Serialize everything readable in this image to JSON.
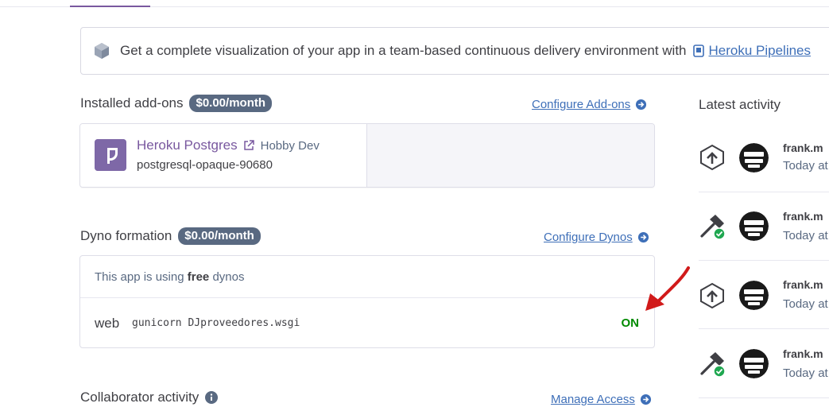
{
  "banner": {
    "text": "Get a complete visualization of your app in a team-based continuous delivery environment with",
    "link": "Heroku Pipelines"
  },
  "addons": {
    "title": "Installed add-ons",
    "price": "$0.00/month",
    "configure_link": "Configure Add-ons",
    "items": [
      {
        "name": "Heroku Postgres",
        "plan": "Hobby Dev",
        "id": "postgresql-opaque-90680"
      }
    ]
  },
  "dynos": {
    "title": "Dyno formation",
    "price": "$0.00/month",
    "configure_link": "Configure Dynos",
    "info_prefix": "This app is using",
    "info_bold": "free",
    "info_suffix": "dynos",
    "processes": [
      {
        "type": "web",
        "command": "gunicorn DJproveedores.wsgi",
        "state": "ON"
      }
    ]
  },
  "collaborators": {
    "title": "Collaborator activity",
    "manage_link": "Manage Access"
  },
  "activity": {
    "title": "Latest activity",
    "items": [
      {
        "kind": "deploy-icon",
        "user": "frank.m",
        "time": "Today at"
      },
      {
        "kind": "build-succeeded-icon",
        "user": "frank.m",
        "time": "Today at"
      },
      {
        "kind": "deploy-icon",
        "user": "frank.m",
        "time": "Today at"
      },
      {
        "kind": "build-succeeded-icon",
        "user": "frank.m",
        "time": "Today at"
      }
    ]
  },
  "colors": {
    "accent": "#79589f",
    "link": "#3e6fb8",
    "badge": "#596981",
    "on_state": "#008a00",
    "annotation": "#d11a1a"
  }
}
